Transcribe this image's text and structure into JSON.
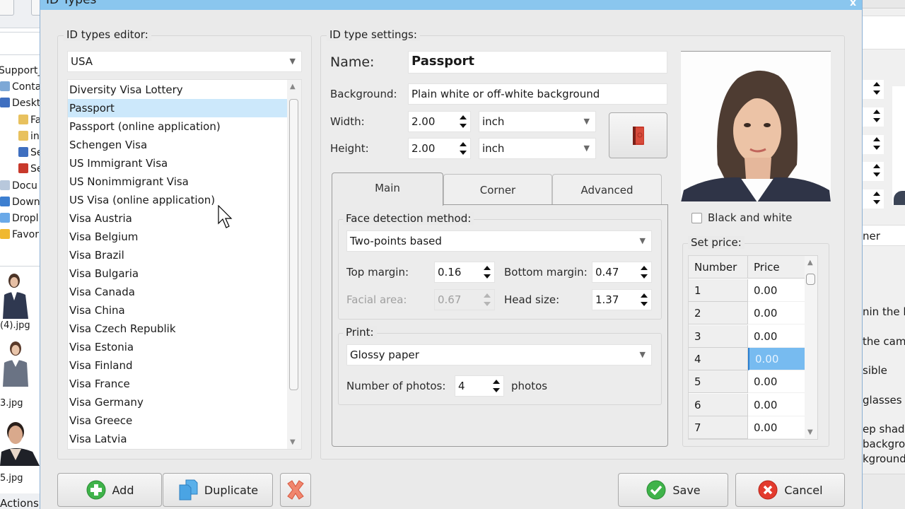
{
  "background_left": {
    "tree": [
      {
        "label": "Support_",
        "icon": "folder-icon"
      },
      {
        "label": "Conta",
        "icon": "contacts-icon"
      },
      {
        "label": "Deskt",
        "icon": "desktop-icon"
      },
      {
        "label": "Fa",
        "icon": "folder-icon"
      },
      {
        "label": "in",
        "icon": "folder-icon"
      },
      {
        "label": "Se",
        "icon": "monitor-icon"
      },
      {
        "label": "Se",
        "icon": "app-icon"
      },
      {
        "label": "Docu",
        "icon": "documents-icon"
      },
      {
        "label": "Down",
        "icon": "downloads-icon"
      },
      {
        "label": "Dropl",
        "icon": "dropbox-icon"
      },
      {
        "label": "Favor",
        "icon": "favorites-icon"
      }
    ],
    "thumbnails": [
      "(4).jpg",
      "3.jpg",
      "5.jpg"
    ],
    "actions_label": "Actions"
  },
  "background_right": {
    "text_input": "ner",
    "lines": [
      "nin the la",
      " the cam",
      "sible",
      "glasses",
      "ep shado",
      "backgrou",
      "kground"
    ]
  },
  "dialog": {
    "title": "ID Types",
    "close_label": "x",
    "editor": {
      "group_title": "ID types editor:",
      "country": "USA",
      "items": [
        "Diversity Visa Lottery",
        "Passport",
        "Passport (online application)",
        "Schengen Visa",
        "US Immigrant Visa",
        "US Nonimmigrant Visa",
        "US Visa (online application)",
        "Visa Austria",
        "Visa Belgium",
        "Visa Brazil",
        "Visa Bulgaria",
        "Visa Canada",
        "Visa China",
        "Visa Czech Republik",
        "Visa Estonia",
        "Visa Finland",
        "Visa France",
        "Visa Germany",
        "Visa Greece",
        "Visa Latvia"
      ],
      "selected_index": 1
    },
    "settings": {
      "group_title": "ID type settings:",
      "name_label": "Name:",
      "name_value": "Passport",
      "background_label": "Background:",
      "background_value": "Plain white or off-white background",
      "width_label": "Width:",
      "width_value": "2.00",
      "width_unit": "inch",
      "height_label": "Height:",
      "height_value": "2.00",
      "height_unit": "inch",
      "tabs": [
        "Main",
        "Corner",
        "Advanced"
      ],
      "active_tab": "Main",
      "face_detection": {
        "group_title": "Face detection method:",
        "method": "Two-points based",
        "top_margin_label": "Top margin:",
        "top_margin": "0.16",
        "bottom_margin_label": "Bottom margin:",
        "bottom_margin": "0.47",
        "facial_area_label": "Facial area:",
        "facial_area": "0.67",
        "head_size_label": "Head size:",
        "head_size": "1.37"
      },
      "print": {
        "group_title": "Print:",
        "paper": "Glossy paper",
        "photos_label": "Number of photos:",
        "photos_value": "4",
        "photos_unit": "photos"
      }
    },
    "preview": {
      "black_and_white_label": "Black and white",
      "black_and_white": false
    },
    "price": {
      "group_title": "Set price:",
      "headers": [
        "Number",
        "Price"
      ],
      "rows": [
        {
          "number": "1",
          "price": "0.00"
        },
        {
          "number": "2",
          "price": "0.00"
        },
        {
          "number": "3",
          "price": "0.00"
        },
        {
          "number": "4",
          "price": "0.00"
        },
        {
          "number": "5",
          "price": "0.00"
        },
        {
          "number": "6",
          "price": "0.00"
        },
        {
          "number": "7",
          "price": "0.00"
        }
      ],
      "selected_row": 3
    },
    "buttons": {
      "add": "Add",
      "duplicate": "Duplicate",
      "save": "Save",
      "cancel": "Cancel"
    }
  },
  "colors": {
    "titlebar": "#8ac6ee",
    "selection": "#cce8fb",
    "cell_selection": "#77bbf0"
  }
}
